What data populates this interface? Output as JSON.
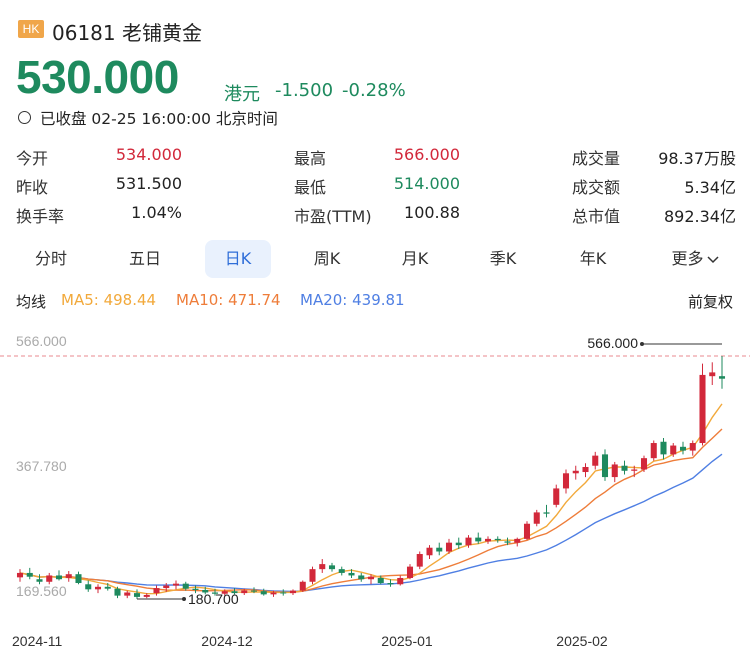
{
  "header": {
    "market_badge": "HK",
    "stock_name": "06181 老铺黄金",
    "price": "530.000",
    "currency": "港元",
    "change": "-1.500",
    "change_pct": "-0.28%",
    "status": "已收盘 02-25 16:00:00 北京时间"
  },
  "quote": {
    "col1": [
      {
        "label": "今开",
        "value": "534.000",
        "tone": "red"
      },
      {
        "label": "昨收",
        "value": "531.500",
        "tone": "dark"
      },
      {
        "label": "换手率",
        "value": "1.04%",
        "tone": "dark"
      }
    ],
    "col2": [
      {
        "label": "最高",
        "value": "566.000",
        "tone": "red"
      },
      {
        "label": "最低",
        "value": "514.000",
        "tone": "green"
      },
      {
        "label": "市盈(TTM)",
        "value": "100.88",
        "tone": "dark"
      }
    ],
    "col3": [
      {
        "label": "成交量",
        "value": "98.37万股",
        "tone": "dark"
      },
      {
        "label": "成交额",
        "value": "5.34亿",
        "tone": "dark"
      },
      {
        "label": "总市值",
        "value": "892.34亿",
        "tone": "dark"
      }
    ]
  },
  "tabs": [
    "分时",
    "五日",
    "日K",
    "周K",
    "月K",
    "季K",
    "年K",
    "更多"
  ],
  "active_tab": "日K",
  "ma": {
    "label": "均线",
    "ma5": "MA5: 498.44",
    "ma10": "MA10: 471.74",
    "ma20": "MA20: 439.81",
    "adjust": "前复权"
  },
  "colors": {
    "up": "#d2283a",
    "down": "#1e8a5e",
    "ma5": "#f2a93b",
    "ma10": "#ee7d3a",
    "ma20": "#4f7fe3",
    "active_tab": "#2f6ed8"
  },
  "chart_data": {
    "type": "candlestick",
    "y_ticks": [
      "566.000",
      "367.780",
      "169.560"
    ],
    "ylim": [
      169.56,
      566.0
    ],
    "x_ticks": [
      "2024-11",
      "2024-12",
      "2025-01",
      "2025-02"
    ],
    "high_marker": "566.000",
    "low_marker": "180.700",
    "candles": [
      {
        "o": 215,
        "h": 228,
        "l": 208,
        "c": 222
      },
      {
        "o": 222,
        "h": 230,
        "l": 212,
        "c": 216
      },
      {
        "o": 212,
        "h": 220,
        "l": 204,
        "c": 208
      },
      {
        "o": 208,
        "h": 222,
        "l": 204,
        "c": 218
      },
      {
        "o": 218,
        "h": 226,
        "l": 210,
        "c": 212
      },
      {
        "o": 214,
        "h": 225,
        "l": 208,
        "c": 220
      },
      {
        "o": 220,
        "h": 224,
        "l": 204,
        "c": 206
      },
      {
        "o": 204,
        "h": 210,
        "l": 192,
        "c": 196
      },
      {
        "o": 196,
        "h": 204,
        "l": 190,
        "c": 200
      },
      {
        "o": 200,
        "h": 206,
        "l": 194,
        "c": 197
      },
      {
        "o": 197,
        "h": 200,
        "l": 182,
        "c": 186
      },
      {
        "o": 186,
        "h": 194,
        "l": 182,
        "c": 191
      },
      {
        "o": 190,
        "h": 196,
        "l": 180.7,
        "c": 184
      },
      {
        "o": 184,
        "h": 190,
        "l": 182,
        "c": 187
      },
      {
        "o": 190,
        "h": 202,
        "l": 186,
        "c": 198
      },
      {
        "o": 198,
        "h": 206,
        "l": 192,
        "c": 202
      },
      {
        "o": 202,
        "h": 210,
        "l": 196,
        "c": 205
      },
      {
        "o": 205,
        "h": 208,
        "l": 194,
        "c": 197
      },
      {
        "o": 197,
        "h": 202,
        "l": 190,
        "c": 195
      },
      {
        "o": 195,
        "h": 200,
        "l": 188,
        "c": 191
      },
      {
        "o": 191,
        "h": 197,
        "l": 186,
        "c": 189
      },
      {
        "o": 189,
        "h": 196,
        "l": 186,
        "c": 193
      },
      {
        "o": 193,
        "h": 198,
        "l": 188,
        "c": 190
      },
      {
        "o": 190,
        "h": 197,
        "l": 187,
        "c": 194
      },
      {
        "o": 194,
        "h": 199,
        "l": 190,
        "c": 193
      },
      {
        "o": 193,
        "h": 197,
        "l": 186,
        "c": 188
      },
      {
        "o": 188,
        "h": 194,
        "l": 184,
        "c": 191
      },
      {
        "o": 191,
        "h": 196,
        "l": 186,
        "c": 190
      },
      {
        "o": 190,
        "h": 196,
        "l": 187,
        "c": 194
      },
      {
        "o": 194,
        "h": 210,
        "l": 192,
        "c": 208
      },
      {
        "o": 208,
        "h": 232,
        "l": 204,
        "c": 228
      },
      {
        "o": 228,
        "h": 244,
        "l": 222,
        "c": 236
      },
      {
        "o": 234,
        "h": 238,
        "l": 224,
        "c": 228
      },
      {
        "o": 228,
        "h": 232,
        "l": 218,
        "c": 222
      },
      {
        "o": 222,
        "h": 228,
        "l": 214,
        "c": 218
      },
      {
        "o": 218,
        "h": 222,
        "l": 208,
        "c": 212
      },
      {
        "o": 212,
        "h": 220,
        "l": 204,
        "c": 216
      },
      {
        "o": 214,
        "h": 218,
        "l": 204,
        "c": 206
      },
      {
        "o": 206,
        "h": 212,
        "l": 200,
        "c": 204
      },
      {
        "o": 204,
        "h": 218,
        "l": 202,
        "c": 214
      },
      {
        "o": 214,
        "h": 236,
        "l": 212,
        "c": 232
      },
      {
        "o": 232,
        "h": 256,
        "l": 228,
        "c": 252
      },
      {
        "o": 250,
        "h": 266,
        "l": 244,
        "c": 262
      },
      {
        "o": 262,
        "h": 270,
        "l": 250,
        "c": 256
      },
      {
        "o": 256,
        "h": 276,
        "l": 252,
        "c": 270
      },
      {
        "o": 270,
        "h": 278,
        "l": 260,
        "c": 266
      },
      {
        "o": 266,
        "h": 282,
        "l": 262,
        "c": 278
      },
      {
        "o": 278,
        "h": 286,
        "l": 268,
        "c": 272
      },
      {
        "o": 272,
        "h": 280,
        "l": 268,
        "c": 276
      },
      {
        "o": 276,
        "h": 280,
        "l": 270,
        "c": 274
      },
      {
        "o": 272,
        "h": 278,
        "l": 266,
        "c": 270
      },
      {
        "o": 270,
        "h": 278,
        "l": 264,
        "c": 276
      },
      {
        "o": 276,
        "h": 304,
        "l": 274,
        "c": 300
      },
      {
        "o": 300,
        "h": 322,
        "l": 296,
        "c": 318
      },
      {
        "o": 318,
        "h": 330,
        "l": 310,
        "c": 316
      },
      {
        "o": 330,
        "h": 362,
        "l": 326,
        "c": 356
      },
      {
        "o": 356,
        "h": 386,
        "l": 348,
        "c": 380
      },
      {
        "o": 380,
        "h": 392,
        "l": 370,
        "c": 384
      },
      {
        "o": 382,
        "h": 396,
        "l": 374,
        "c": 390
      },
      {
        "o": 392,
        "h": 414,
        "l": 386,
        "c": 408
      },
      {
        "o": 410,
        "h": 418,
        "l": 368,
        "c": 374
      },
      {
        "o": 374,
        "h": 398,
        "l": 366,
        "c": 394
      },
      {
        "o": 392,
        "h": 400,
        "l": 378,
        "c": 384
      },
      {
        "o": 384,
        "h": 392,
        "l": 374,
        "c": 386
      },
      {
        "o": 386,
        "h": 408,
        "l": 382,
        "c": 404
      },
      {
        "o": 404,
        "h": 432,
        "l": 400,
        "c": 428
      },
      {
        "o": 430,
        "h": 436,
        "l": 402,
        "c": 410
      },
      {
        "o": 410,
        "h": 428,
        "l": 406,
        "c": 424
      },
      {
        "o": 422,
        "h": 430,
        "l": 410,
        "c": 416
      },
      {
        "o": 416,
        "h": 432,
        "l": 408,
        "c": 428
      },
      {
        "o": 428,
        "h": 554,
        "l": 424,
        "c": 536
      },
      {
        "o": 534,
        "h": 556,
        "l": 520,
        "c": 540
      },
      {
        "o": 534,
        "h": 566,
        "l": 514,
        "c": 530
      }
    ]
  }
}
